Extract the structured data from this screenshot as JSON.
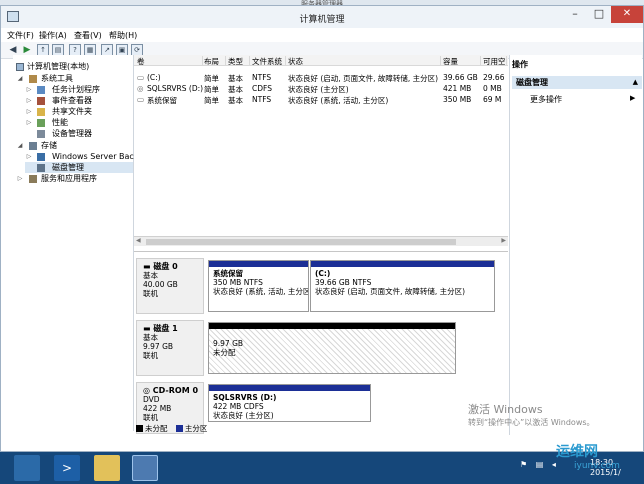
{
  "parent_window_title": "服务器管理器",
  "window": {
    "title": "计算机管理"
  },
  "menu": [
    "文件(F)",
    "操作(A)",
    "查看(V)",
    "帮助(H)"
  ],
  "nav": {
    "root": "计算机管理(本地)",
    "system_tools": "系统工具",
    "task_scheduler": "任务计划程序",
    "event_viewer": "事件查看器",
    "shared_folders": "共享文件夹",
    "performance": "性能",
    "device_manager": "设备管理器",
    "storage": "存储",
    "windows_server_backup": "Windows Server Back",
    "disk_management": "磁盘管理",
    "services_apps": "服务和应用程序"
  },
  "volumes": {
    "columns": [
      "卷",
      "布局",
      "类型",
      "文件系统",
      "状态",
      "容量",
      "可用空"
    ],
    "rows": [
      {
        "name": "(C:)",
        "layout": "简单",
        "type": "基本",
        "fs": "NTFS",
        "status": "状态良好 (启动, 页面文件, 故障转储, 主分区)",
        "capacity": "39.66 GB",
        "free": "29.66"
      },
      {
        "name": "SQLSRVRS (D:)",
        "layout": "简单",
        "type": "基本",
        "fs": "CDFS",
        "status": "状态良好 (主分区)",
        "capacity": "421 MB",
        "free": "0 MB"
      },
      {
        "name": "系统保留",
        "layout": "简单",
        "type": "基本",
        "fs": "NTFS",
        "status": "状态良好 (系统, 活动, 主分区)",
        "capacity": "350 MB",
        "free": "69 M"
      }
    ]
  },
  "disks": [
    {
      "name": "磁盘 0",
      "kind": "基本",
      "size": "40.00 GB",
      "state": "联机",
      "partitions": [
        {
          "title": "系统保留",
          "size": "350 MB NTFS",
          "status": "状态良好 (系统, 活动, 主分区)"
        },
        {
          "title": "(C:)",
          "size": "39.66 GB NTFS",
          "status": "状态良好 (启动, 页面文件, 故障转储, 主分区)"
        }
      ]
    },
    {
      "name": "磁盘 1",
      "kind": "基本",
      "size": "9.97 GB",
      "state": "联机",
      "partitions": [
        {
          "title": "",
          "size": "9.97 GB",
          "status": "未分配"
        }
      ]
    },
    {
      "name": "CD-ROM 0",
      "kind": "DVD",
      "size": "422 MB",
      "state": "联机",
      "partitions": [
        {
          "title": "SQLSRVRS (D:)",
          "size": "422 MB CDFS",
          "status": "状态良好 (主分区)"
        }
      ]
    }
  ],
  "legend": {
    "unallocated": "未分配",
    "primary": "主分区"
  },
  "actions": {
    "header": "操作",
    "section": "磁盘管理",
    "more": "更多操作"
  },
  "watermark": {
    "line1": "激活 Windows",
    "line2": "转到“操作中心”以激活 Windows。"
  },
  "clock": {
    "time": "18:30",
    "date": "2015/1/"
  },
  "site_logo": {
    "text": "运维网",
    "sub": "iyunv.com"
  },
  "colors": {
    "primary_partition": "#1c2f96",
    "unallocated": "#000000",
    "taskbar": "#15477a",
    "selection": "#d8e6f3"
  }
}
